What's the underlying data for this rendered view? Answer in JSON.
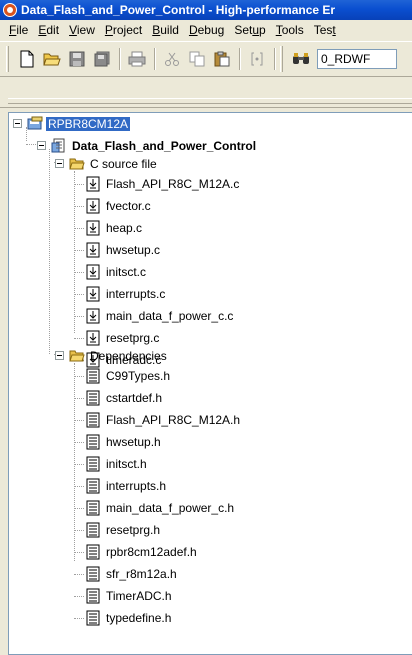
{
  "window": {
    "title": "Data_Flash_and_Power_Control - High-performance Er"
  },
  "menu": [
    {
      "before": "",
      "key": "F",
      "after": "ile"
    },
    {
      "before": "",
      "key": "E",
      "after": "dit"
    },
    {
      "before": "",
      "key": "V",
      "after": "iew"
    },
    {
      "before": "",
      "key": "P",
      "after": "roject"
    },
    {
      "before": "",
      "key": "B",
      "after": "uild"
    },
    {
      "before": "",
      "key": "D",
      "after": "ebug"
    },
    {
      "before": "Set",
      "key": "u",
      "after": "p"
    },
    {
      "before": "",
      "key": "T",
      "after": "ools"
    },
    {
      "before": "Tes",
      "key": "t",
      "after": ""
    }
  ],
  "toolbar": {
    "config_value": "0_RDWF"
  },
  "tree": {
    "workspace": "RPBR8CM12A",
    "project": "Data_Flash_and_Power_Control",
    "c_source_folder": "C source file",
    "c_source_files": [
      "Flash_API_R8C_M12A.c",
      "fvector.c",
      "heap.c",
      "hwsetup.c",
      "initsct.c",
      "interrupts.c",
      "main_data_f_power_c.c",
      "resetprg.c",
      "timeradc.c"
    ],
    "dependencies_folder": "Dependencies",
    "dependency_files": [
      "C99Types.h",
      "cstartdef.h",
      "Flash_API_R8C_M12A.h",
      "hwsetup.h",
      "initsct.h",
      "interrupts.h",
      "main_data_f_power_c.h",
      "resetprg.h",
      "rpbr8cm12adef.h",
      "sfr_r8m12a.h",
      "TimerADC.h",
      "typedefine.h"
    ]
  },
  "colors": {
    "titlebar": "#0a4fd0",
    "selection": "#316ac5",
    "window_bg": "#ece9d8",
    "folder": "#f5d76e"
  }
}
